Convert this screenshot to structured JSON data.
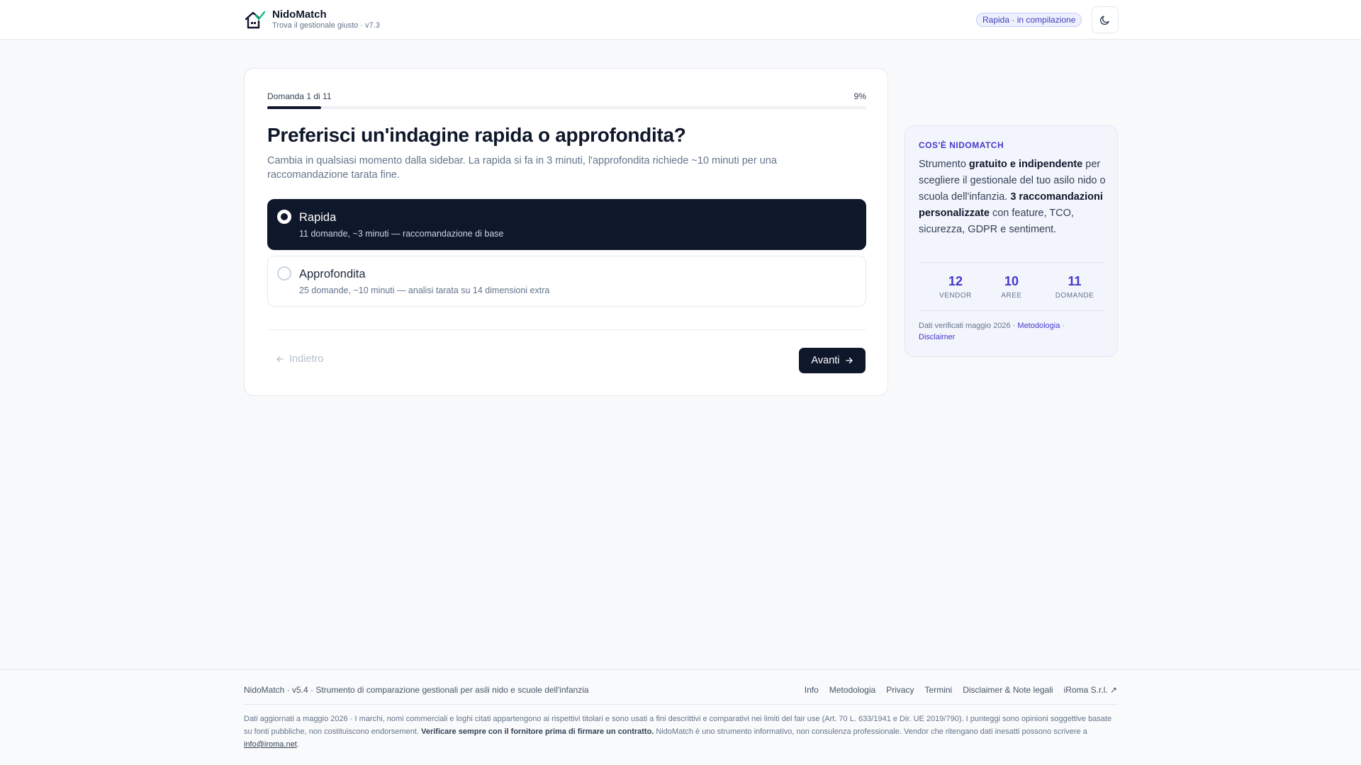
{
  "header": {
    "brand_name": "NidoMatch",
    "brand_sub": "Trova il gestionale giusto · v7.3",
    "status": "Rapida · in compilazione",
    "theme_icon": "moon-icon"
  },
  "quiz": {
    "progress_label": "Domanda 1 di 11",
    "progress_pct_label": "9%",
    "progress_fraction": 0.09,
    "title": "Preferisci un'indagine rapida o approfondita?",
    "description": "Cambia in qualsiasi momento dalla sidebar. La rapida si fa in 3 minuti, l'approfondita richiede ~10 minuti per una raccomandazione tarata fine.",
    "options": [
      {
        "title": "Rapida",
        "sub": "11 domande, ~3 minuti — raccomandazione di base",
        "selected": true
      },
      {
        "title": "Approfondita",
        "sub": "25 domande, ~10 minuti — analisi tarata su 14 dimensioni extra",
        "selected": false
      }
    ],
    "back_label": "Indietro",
    "next_label": "Avanti"
  },
  "sidebar": {
    "heading": "COS'È NIDOMATCH",
    "body_1": "Strumento ",
    "body_b1": "gratuito e indipendente",
    "body_2": " per scegliere il gestionale del tuo asilo nido o scuola dell'infanzia. ",
    "body_b2": "3 raccomandazioni personalizzate",
    "body_3": " con feature, TCO, sicurezza, GDPR e sentiment.",
    "stats": [
      {
        "num": "12",
        "label": "VENDOR"
      },
      {
        "num": "10",
        "label": "AREE"
      },
      {
        "num": "11",
        "label": "DOMANDE"
      }
    ],
    "foot_text": "Dati verificati maggio 2026 · ",
    "link_method": "Metodologia",
    "sep": " · ",
    "link_disclaimer": "Disclaimer"
  },
  "footer": {
    "title": "NidoMatch · v5.4 · Strumento di comparazione gestionali per asili nido e scuole dell'infanzia",
    "links": [
      "Info",
      "Metodologia",
      "Privacy",
      "Termini",
      "Disclaimer & Note legali",
      "iRoma S.r.l. ↗"
    ],
    "text_1": "Dati aggiornati a maggio 2026 · I marchi, nomi commerciali e loghi citati appartengono ai rispettivi titolari e sono usati a fini descrittivi e comparativi nei limiti del fair use (Art. 70 L. 633/1941 e Dir. UE 2019/790). I punteggi sono opinioni soggettive basate su fonti pubbliche, non costituiscono endorsement. ",
    "text_bold": "Verificare sempre con il fornitore prima di firmare un contratto.",
    "text_2": " NidoMatch è uno strumento informativo, non consulenza professionale. Vendor che ritengano dati inesatti possono scrivere a ",
    "email": "info@iroma.net",
    "text_3": "."
  }
}
